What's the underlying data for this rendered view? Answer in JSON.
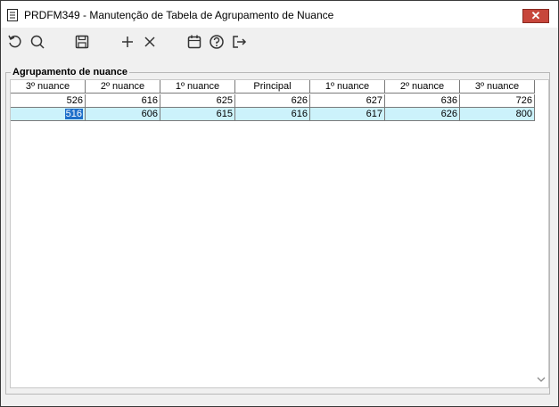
{
  "window": {
    "title": "PRDFM349 - Manutenção de Tabela de Agrupamento de Nuance",
    "close_glyph": "✕"
  },
  "toolbar": {
    "buttons": [
      {
        "name": "refresh-icon"
      },
      {
        "name": "search-icon"
      },
      {
        "name": "save-icon"
      },
      {
        "name": "add-icon"
      },
      {
        "name": "delete-icon"
      },
      {
        "name": "calendar-icon"
      },
      {
        "name": "help-icon"
      },
      {
        "name": "exit-icon"
      }
    ]
  },
  "group": {
    "title": "Agrupamento de nuance"
  },
  "table": {
    "columns": [
      "3º nuance",
      "2º nuance",
      "1º nuance",
      "Principal",
      "1º nuance",
      "2º nuance",
      "3º nuance"
    ],
    "rows": [
      [
        "526",
        "616",
        "625",
        "626",
        "627",
        "636",
        "726"
      ],
      [
        "516",
        "606",
        "615",
        "616",
        "617",
        "626",
        "800"
      ]
    ],
    "selected_row": 1,
    "selected_cell": 0
  },
  "colors": {
    "selected_row_bg": "#ccf2fb",
    "selection_highlight": "#1e6fc9",
    "close_button": "#c7463b"
  }
}
